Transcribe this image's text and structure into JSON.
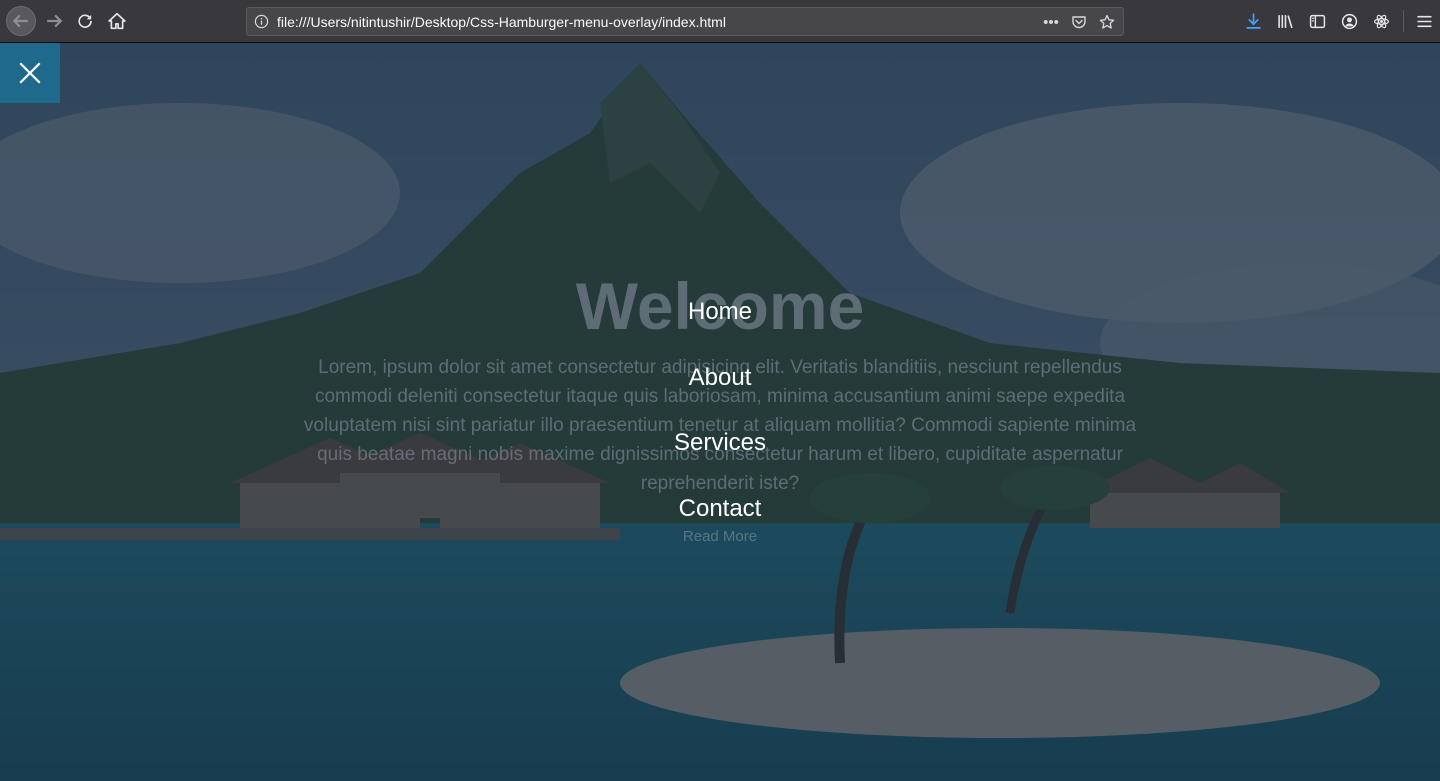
{
  "browser": {
    "url": "file:///Users/nitintushir/Desktop/Css-Hamburger-menu-overlay/index.html",
    "page_actions_label": "•••",
    "icons": {
      "back": "back-arrow-icon",
      "forward": "forward-arrow-icon",
      "reload": "reload-icon",
      "home": "home-icon",
      "info": "info-icon",
      "pocket": "pocket-icon",
      "bookmark": "star-icon",
      "download": "download-icon",
      "library": "library-icon",
      "sidebar": "sidebar-icon",
      "account": "account-icon",
      "extension": "react-devtools-icon",
      "menu": "hamburger-menu-icon"
    },
    "download_color": "#45a1ff"
  },
  "page": {
    "hero": {
      "title": "Welcome",
      "text": "Lorem, ipsum dolor sit amet consectetur adipisicing elit. Veritatis blanditiis, nesciunt repellendus commodi deleniti consectetur itaque quis laboriosam, minima accusantium animi saepe expedita voluptatem nisi sint pariatur illo praesentium tenetur at aliquam mollitia? Commodi sapiente minima quis beatae magni nobis maxime dignissimos consectetur harum et libero, cupiditate aspernatur reprehenderit iste?",
      "read_more": "Read More"
    },
    "menu_toggle": {
      "icon": "close-icon",
      "color": "#1f6a8c"
    },
    "menu": {
      "items": [
        {
          "label": "Home"
        },
        {
          "label": "About"
        },
        {
          "label": "Services"
        },
        {
          "label": "Contact"
        }
      ]
    }
  }
}
